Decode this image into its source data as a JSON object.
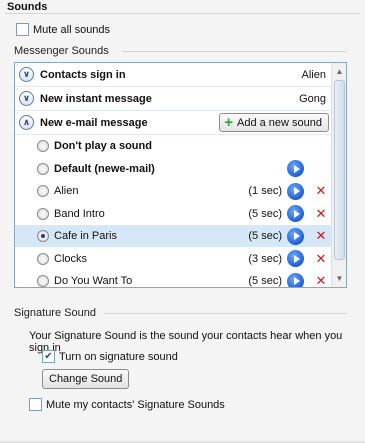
{
  "section_title": "Sounds",
  "mute_all": {
    "label": "Mute all sounds",
    "checked": false
  },
  "messenger_sounds": {
    "group_label": "Messenger Sounds",
    "headers": [
      {
        "label": "Contacts sign in",
        "value": "Alien",
        "expanded": false
      },
      {
        "label": "New instant message",
        "value": "Gong",
        "expanded": false
      },
      {
        "label": "New e-mail message",
        "value": "",
        "expanded": true
      }
    ],
    "add_button_label": "Add a new sound",
    "options": [
      {
        "label": "Don't play a sound",
        "duration": "",
        "bold": true,
        "selected": false,
        "play": false,
        "delete": false
      },
      {
        "label": "Default (newe-mail)",
        "duration": "",
        "bold": true,
        "selected": false,
        "play": true,
        "delete": false
      },
      {
        "label": "Alien",
        "duration": "(1 sec)",
        "bold": false,
        "selected": false,
        "play": true,
        "delete": true
      },
      {
        "label": "Band Intro",
        "duration": "(5 sec)",
        "bold": false,
        "selected": false,
        "play": true,
        "delete": true
      },
      {
        "label": "Cafe in Paris",
        "duration": "(5 sec)",
        "bold": false,
        "selected": true,
        "play": true,
        "delete": true
      },
      {
        "label": "Clocks",
        "duration": "(3 sec)",
        "bold": false,
        "selected": false,
        "play": true,
        "delete": true
      },
      {
        "label": "Do You Want To",
        "duration": "(5 sec)",
        "bold": false,
        "selected": false,
        "play": true,
        "delete": true
      }
    ],
    "icons": {
      "chevron_collapsed": "chevron-down-icon",
      "chevron_expanded": "chevron-up-icon",
      "play": "play-icon",
      "delete": "delete-icon"
    }
  },
  "signature": {
    "group_label": "Signature Sound",
    "description": "Your Signature Sound is the sound your contacts hear when you sign in",
    "turn_on": {
      "label": "Turn on signature sound",
      "checked": true
    },
    "change_button_label": "Change Sound",
    "mute_contacts": {
      "label": "Mute my contacts' Signature Sounds",
      "checked": false
    }
  },
  "colors": {
    "selected_row": "#d6e7f7",
    "play": "#1d5fd1",
    "delete": "#d11818",
    "list_border": "#8aa4c4"
  }
}
